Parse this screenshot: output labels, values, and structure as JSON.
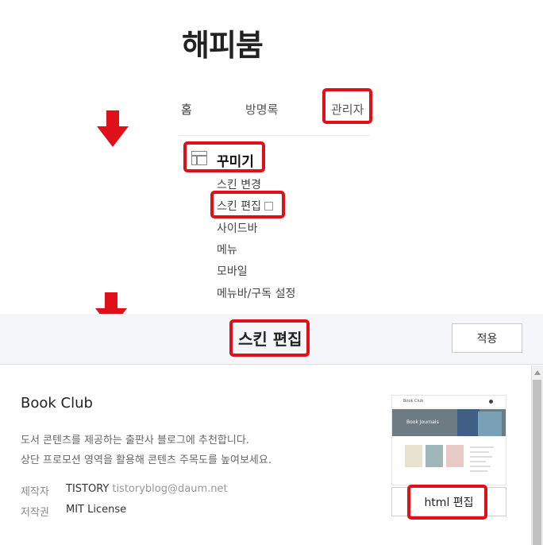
{
  "blog": {
    "title": "해피붐"
  },
  "nav": {
    "items": [
      {
        "label": "홈"
      },
      {
        "label": "방명록"
      },
      {
        "label": "관리자"
      }
    ]
  },
  "menu": {
    "section": "꾸미기",
    "items": [
      {
        "label": "스킨 변경"
      },
      {
        "label": "스킨 편집"
      },
      {
        "label": "사이드바"
      },
      {
        "label": "메뉴"
      },
      {
        "label": "모바일"
      },
      {
        "label": "메뉴바/구독 설정"
      }
    ]
  },
  "editor": {
    "title": "스킨 편집",
    "apply_label": "적용"
  },
  "skin": {
    "name": "Book Club",
    "description": [
      "도서 콘텐츠를 제공하는 출판사 블로그에 추천합니다.",
      "상단 프로모션 영역을 활용해 콘텐츠 주목도를 높여보세요."
    ],
    "maker_label": "제작자",
    "maker": "TISTORY",
    "maker_email": "tistoryblog@daum.net",
    "license_label": "저작권",
    "license": "MIT License",
    "thumbnail": {
      "header_text": "Book Club",
      "banner_text": "Book Journals"
    },
    "html_edit_label": "html 편집"
  },
  "colors": {
    "highlight": "#e0101b",
    "arrow": "#e0101b",
    "editor_bar": "#f4f6f9"
  }
}
